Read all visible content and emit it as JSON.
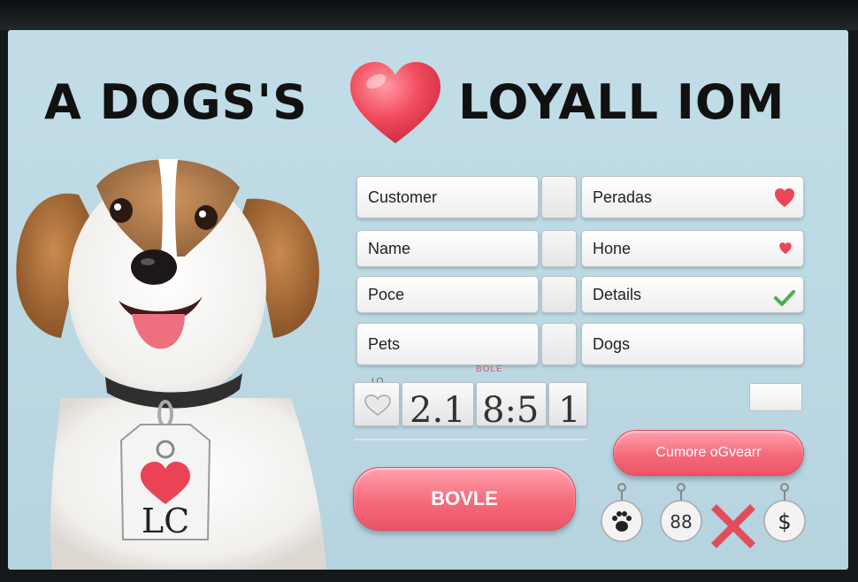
{
  "header": {
    "title_left": "A DOGS'S",
    "title_right": "LOYALL IOM"
  },
  "form": {
    "rows": [
      {
        "left": "Customer",
        "right": "Peradas",
        "right_icon": "heart-icon"
      },
      {
        "left": "Name",
        "right": "Hone",
        "right_icon": "small-heart-icon"
      },
      {
        "left": "Poce",
        "right": "Details",
        "right_icon": "checkmark-icon"
      },
      {
        "left": "Pets",
        "right": "Dogs",
        "right_icon": ""
      }
    ]
  },
  "counter": {
    "top_label": "LO",
    "caption": "BOLE",
    "digits_a": "2.1",
    "digits_b": "8:5",
    "digits_c": "1",
    "digits_d": "1"
  },
  "buttons": {
    "secondary_label": "Cumore oGvearr",
    "primary_label": "BOVLE"
  },
  "tag": {
    "label": "LC"
  },
  "charms": [
    {
      "icon": "paw-icon"
    },
    {
      "icon": "link-icon",
      "text": "88"
    },
    {
      "icon": "close-icon"
    },
    {
      "icon": "dollar-icon",
      "text": "$"
    }
  ],
  "colors": {
    "accent": "#f2606f",
    "heart": "#ec4656",
    "check": "#4cae4c",
    "background": "#bcd8e3"
  }
}
